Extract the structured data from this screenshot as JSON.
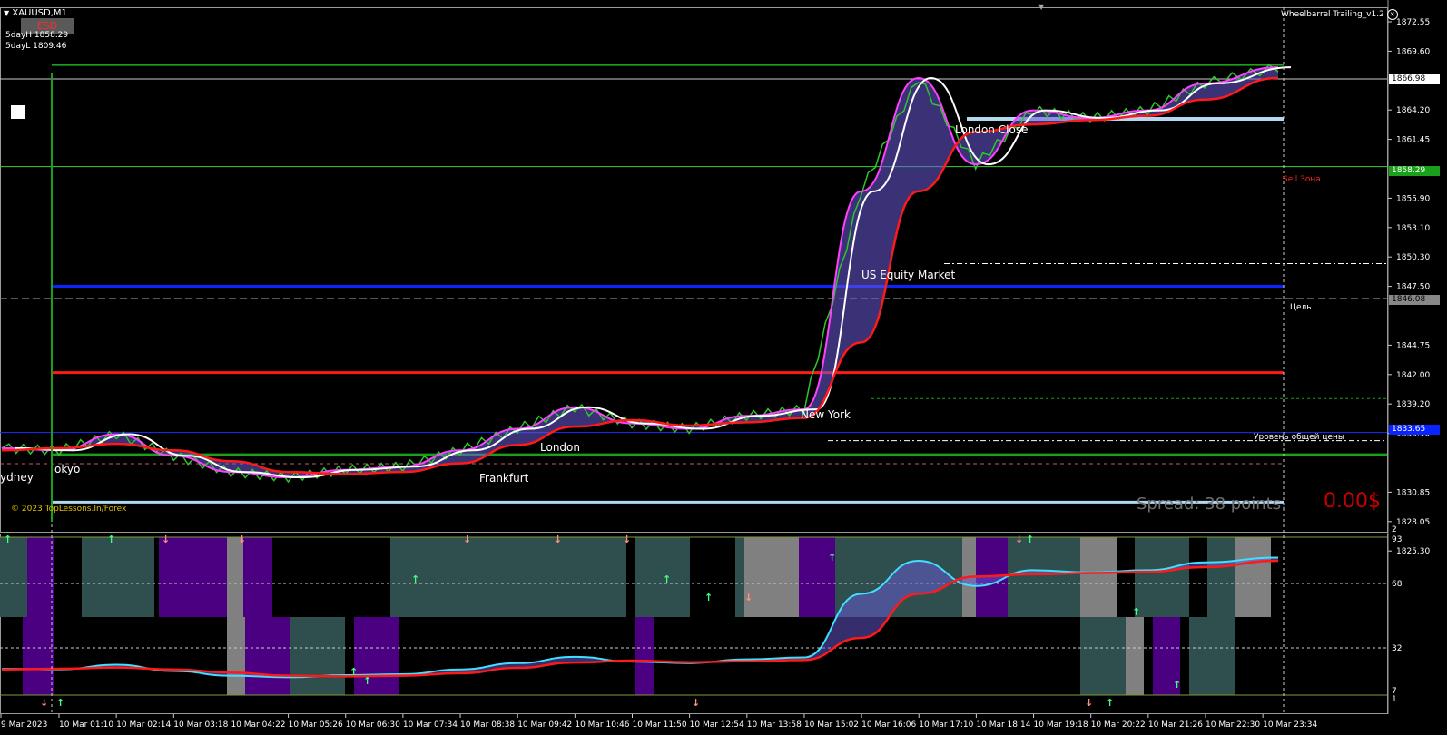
{
  "symbol": "XAUUSD,M1",
  "indicator_name": "Wheelbarrel Trailing_v1.2",
  "esd_badge": "ESD",
  "five_day": {
    "high": "5dayH 1858.29",
    "low": "5dayL 1809.46"
  },
  "copyright": "© 2023 TopLessons.In/Forex",
  "spread_text": "Spread: 38 points.",
  "profit_text": "0.00$",
  "sessions": [
    "ydney",
    "okyo",
    "Frankfurt",
    "London",
    "New York",
    "US Equity Market",
    "London Close"
  ],
  "level_labels": {
    "sell_zone": "Sell Зона",
    "target": "Цель",
    "avg_price": "Уровень общей цены"
  },
  "price_axis": [
    "1872.55",
    "1869.60",
    "1866.98",
    "1864.20",
    "1861.45",
    "1858.29",
    "1855.90",
    "1853.10",
    "1850.30",
    "1847.50",
    "1846.08",
    "1844.75",
    "1842.00",
    "1839.20",
    "1836.40",
    "1833.65",
    "1830.85",
    "1828.05",
    "1825.30"
  ],
  "price_tags": {
    "current": "1866.98",
    "sell": "1858.29",
    "target": "1846.08",
    "avg": "1833.65"
  },
  "sub_axis": [
    "2",
    "93",
    "68",
    "32",
    "7",
    "1"
  ],
  "time_axis": [
    "9 Mar 2023",
    "10 Mar 01:10",
    "10 Mar 02:14",
    "10 Mar 03:18",
    "10 Mar 04:22",
    "10 Mar 05:26",
    "10 Mar 06:30",
    "10 Mar 07:34",
    "10 Mar 08:38",
    "10 Mar 09:42",
    "10 Mar 10:46",
    "10 Mar 11:50",
    "10 Mar 12:54",
    "10 Mar 13:58",
    "10 Mar 15:02",
    "10 Mar 16:06",
    "10 Mar 17:10",
    "10 Mar 18:14",
    "10 Mar 19:18",
    "10 Mar 20:22",
    "10 Mar 21:26",
    "10 Mar 22:30",
    "10 Mar 23:34"
  ],
  "colors": {
    "bg": "#000000",
    "white_ma": "#ffffff",
    "red_ma": "#ff1a1a",
    "magenta": "#ff40ff",
    "fill": "#6a5ad8",
    "blue_line": "#0a24ff",
    "green_line": "#1aa01a",
    "light_blue": "#b0d8f0",
    "teal_block": "#2f4f4f",
    "purple_block": "#4b0082",
    "gray_block": "#808080"
  },
  "chart_data": {
    "type": "line",
    "title": "XAUUSD,M1",
    "x": [
      "9 Mar 2023",
      "10 Mar 01:10",
      "10 Mar 02:14",
      "10 Mar 03:18",
      "10 Mar 04:22",
      "10 Mar 05:26",
      "10 Mar 06:30",
      "10 Mar 07:34",
      "10 Mar 08:38",
      "10 Mar 09:42",
      "10 Mar 10:46",
      "10 Mar 11:50",
      "10 Mar 12:54",
      "10 Mar 13:58",
      "10 Mar 15:02",
      "10 Mar 16:06",
      "10 Mar 17:10",
      "10 Mar 18:14",
      "10 Mar 19:18",
      "10 Mar 20:22",
      "10 Mar 21:26",
      "10 Mar 22:30",
      "10 Mar 23:34"
    ],
    "ylim": [
      1825.3,
      1872.55
    ],
    "series": [
      {
        "values": [
          1832.2,
          1832.0,
          1833.5,
          1831.5,
          1830.0,
          1829.5,
          1830.2,
          1830.5,
          1832.0,
          1834.0,
          1836.0,
          1834.5,
          1834.0,
          1835.2,
          1835.8,
          1856.0,
          1866.5,
          1858.5,
          1863.5,
          1862.8,
          1863.5,
          1866.0,
          1867.5
        ]
      },
      {
        "values": [
          1832.0,
          1832.2,
          1832.6,
          1832.0,
          1831.0,
          1830.0,
          1829.8,
          1830.0,
          1830.8,
          1832.5,
          1834.2,
          1834.8,
          1834.3,
          1834.6,
          1835.0,
          1842.0,
          1856.0,
          1861.5,
          1862.2,
          1862.6,
          1863.0,
          1864.5,
          1866.5
        ]
      }
    ],
    "levels": [
      1867.7,
      1858.29,
      1849.3,
      1847.2,
      1846.08,
      1839.2,
      1836.8,
      1833.65,
      1832.9,
      1831.6,
      1827.2
    ]
  }
}
